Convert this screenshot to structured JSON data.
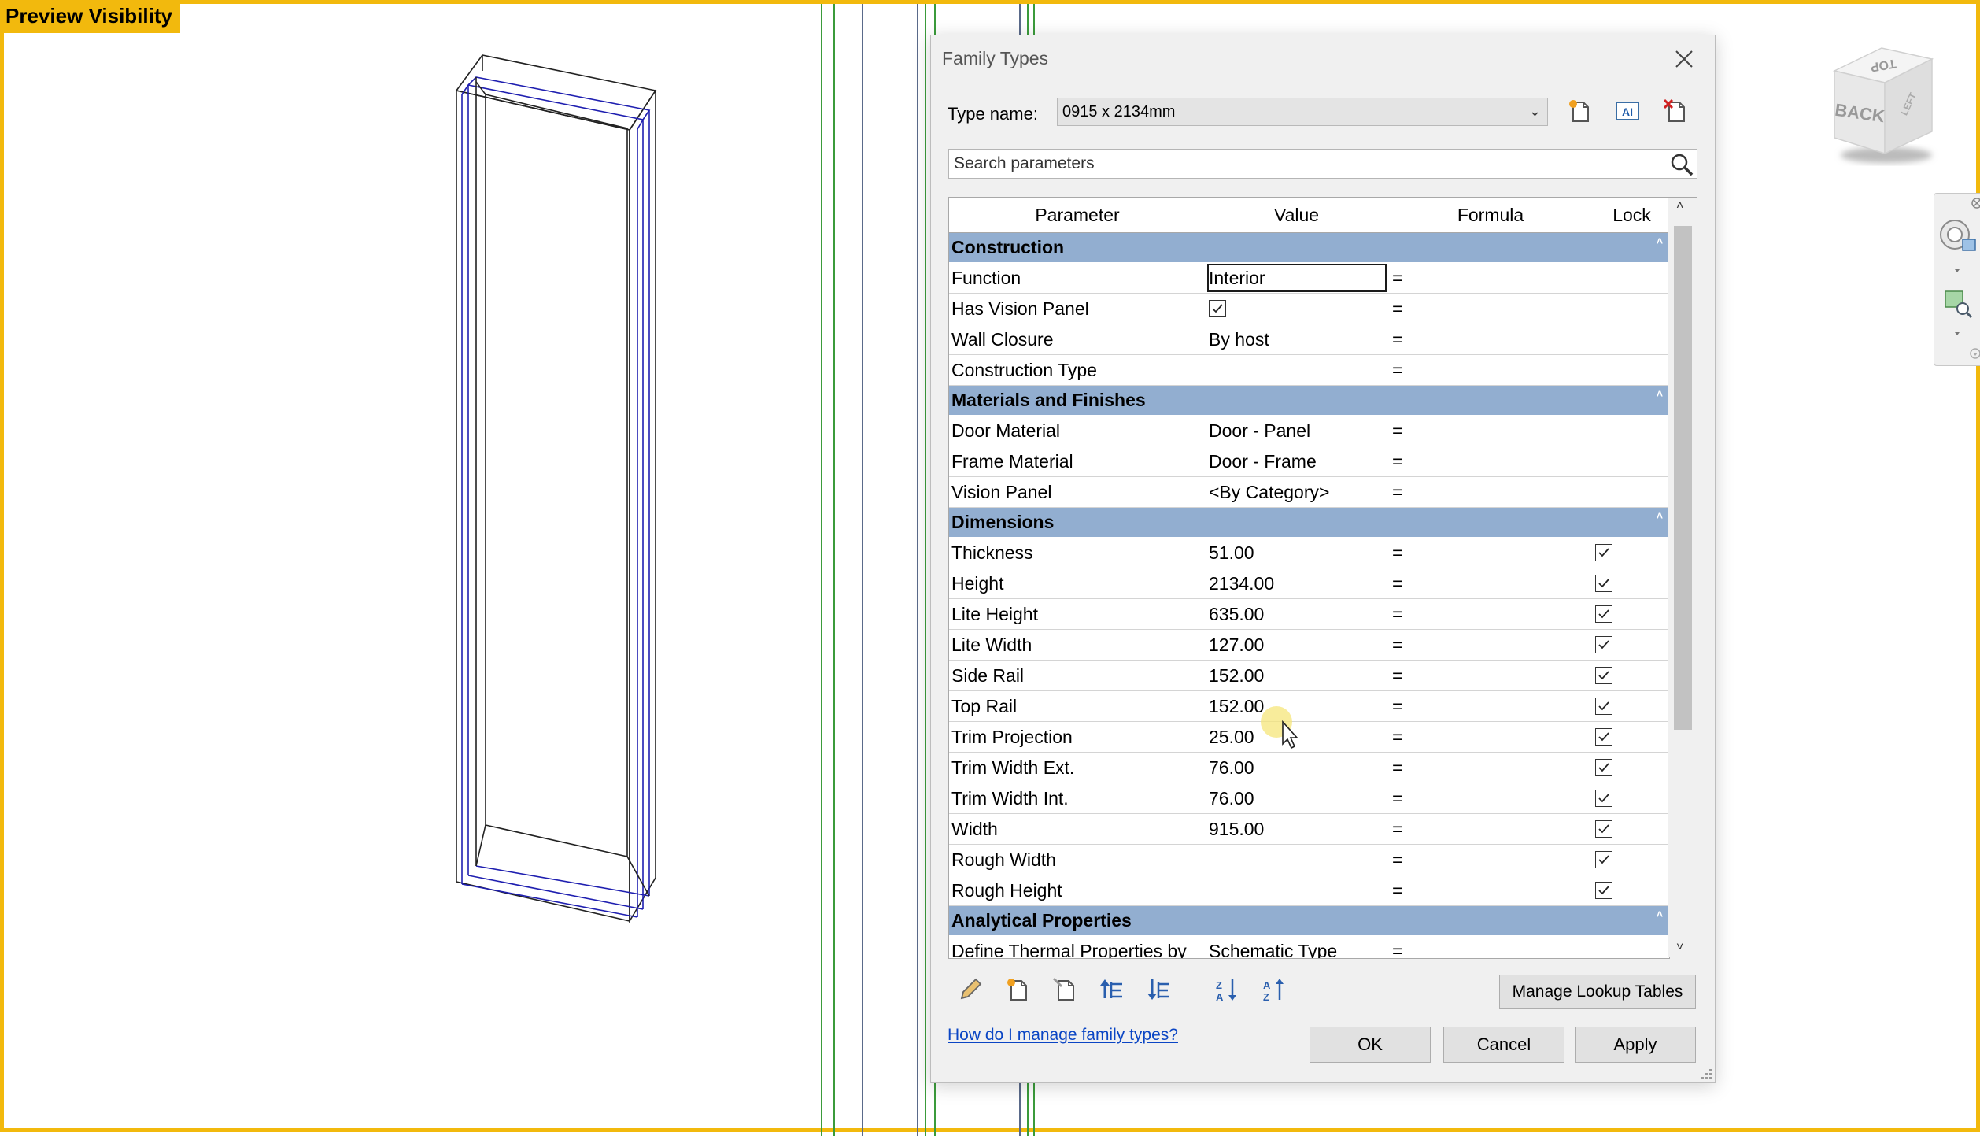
{
  "preview_badge": "Preview Visibility",
  "view_cube": {
    "top_label": "TOP",
    "front_label": "BACK",
    "side_label": "LEFT"
  },
  "dialog": {
    "title": "Family Types",
    "type_name_label": "Type name:",
    "type_name_value": "0915 x 2134mm",
    "search_placeholder": "Search parameters",
    "columns": [
      "Parameter",
      "Value",
      "Formula",
      "Lock"
    ],
    "groups": [
      {
        "name": "Construction",
        "rows": [
          {
            "parameter": "Function",
            "value": "Interior",
            "formula": "=",
            "lock": null,
            "editing": true
          },
          {
            "parameter": "Has Vision Panel",
            "value": "",
            "checkbox_value": true,
            "formula": "=",
            "lock": null
          },
          {
            "parameter": "Wall Closure",
            "value": "By host",
            "formula": "=",
            "lock": null
          },
          {
            "parameter": "Construction Type",
            "value": "",
            "formula": "=",
            "lock": null
          }
        ]
      },
      {
        "name": "Materials and Finishes",
        "rows": [
          {
            "parameter": "Door Material",
            "value": "Door - Panel",
            "formula": "=",
            "lock": null
          },
          {
            "parameter": "Frame Material",
            "value": "Door - Frame",
            "formula": "=",
            "lock": null
          },
          {
            "parameter": "Vision Panel",
            "value": "<By Category>",
            "formula": "=",
            "lock": null
          }
        ]
      },
      {
        "name": "Dimensions",
        "rows": [
          {
            "parameter": "Thickness",
            "value": "51.00",
            "formula": "=",
            "lock": true
          },
          {
            "parameter": "Height",
            "value": "2134.00",
            "formula": "=",
            "lock": true
          },
          {
            "parameter": "Lite Height",
            "value": "635.00",
            "formula": "=",
            "lock": true
          },
          {
            "parameter": "Lite Width",
            "value": "127.00",
            "formula": "=",
            "lock": true
          },
          {
            "parameter": "Side Rail",
            "value": "152.00",
            "formula": "=",
            "lock": true
          },
          {
            "parameter": "Top Rail",
            "value": "152.00",
            "formula": "=",
            "lock": true
          },
          {
            "parameter": "Trim Projection",
            "value": "25.00",
            "formula": "=",
            "lock": true
          },
          {
            "parameter": "Trim Width Ext.",
            "value": "76.00",
            "formula": "=",
            "lock": true
          },
          {
            "parameter": "Trim Width Int.",
            "value": "76.00",
            "formula": "=",
            "lock": true
          },
          {
            "parameter": "Width",
            "value": "915.00",
            "formula": "=",
            "lock": true
          },
          {
            "parameter": "Rough Width",
            "value": "",
            "formula": "=",
            "lock": true
          },
          {
            "parameter": "Rough Height",
            "value": "",
            "formula": "=",
            "lock": true
          }
        ]
      },
      {
        "name": "Analytical Properties",
        "rows": [
          {
            "parameter": "Define Thermal Properties by",
            "value": "Schematic Type",
            "formula": "=",
            "lock": null
          }
        ]
      }
    ],
    "manage_lookup_label": "Manage Lookup Tables",
    "help_link": "How do I manage family types?",
    "ok_label": "OK",
    "cancel_label": "Cancel",
    "apply_label": "Apply",
    "scroll_position": 0.0
  }
}
